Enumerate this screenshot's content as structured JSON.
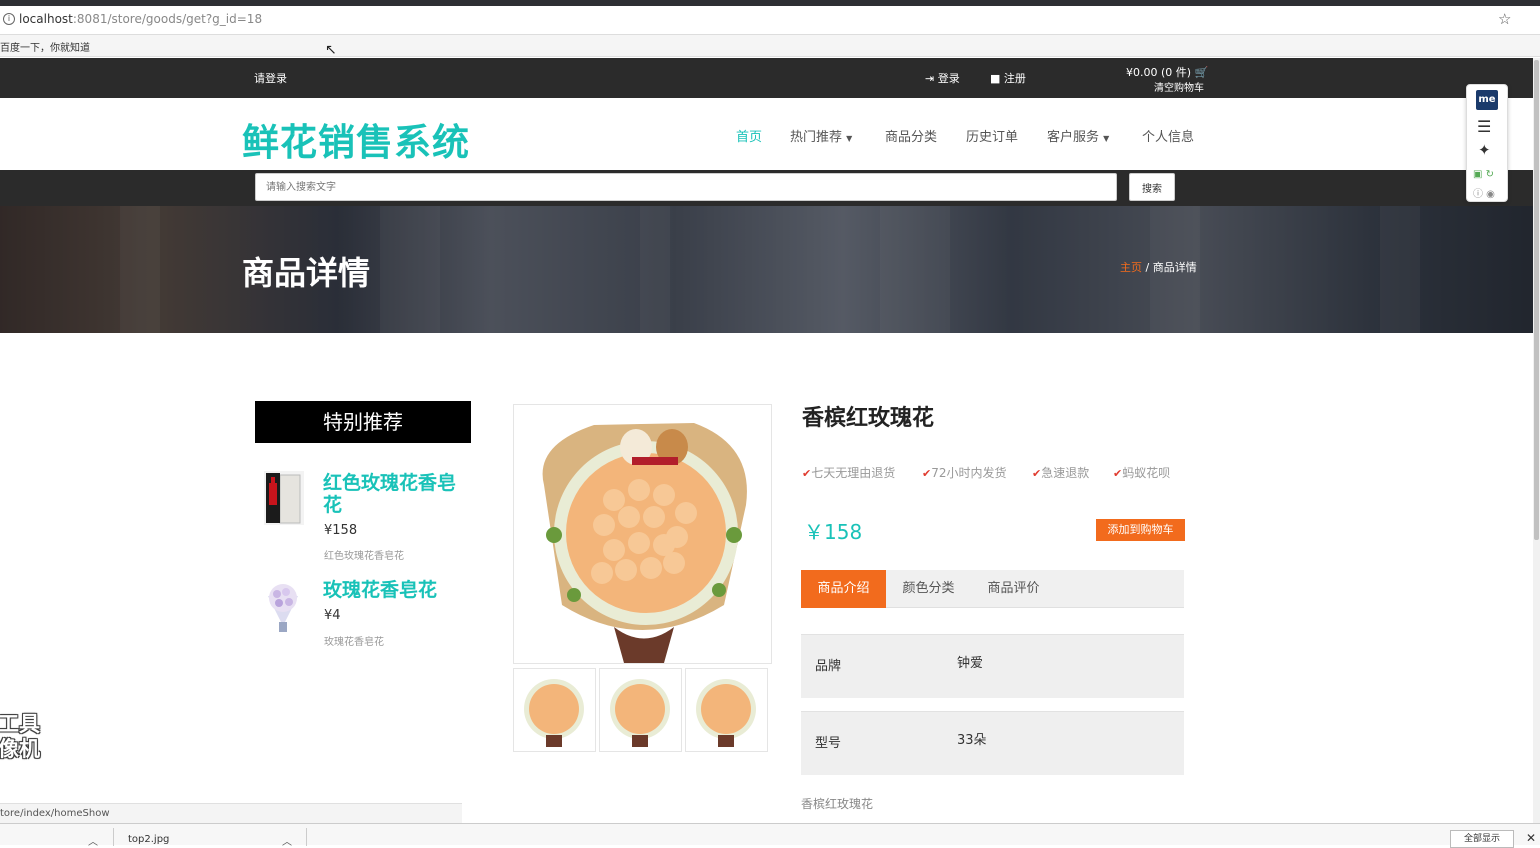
{
  "browser": {
    "url_host": "localhost",
    "url_rest": ":8081/store/goods/get?g_id=18",
    "bookmark": "百度一下，你就知道",
    "status_url": "tore/index/homeShow",
    "download_file": "top2.jpg",
    "show_all": "全部显示"
  },
  "topnav": {
    "please_login": "请登录",
    "login": "登录",
    "register": "注册",
    "cart_amount": "¥0.00 (0 件)",
    "cart_clear": "清空购物车"
  },
  "header": {
    "logo": "鲜花销售系统",
    "nav": [
      "首页",
      "热门推荐",
      "商品分类",
      "历史订单",
      "客户服务",
      "个人信息"
    ]
  },
  "search": {
    "placeholder": "请输入搜索文字",
    "button": "搜索"
  },
  "hero": {
    "title": "商品详情",
    "breadcrumb_home": "主页",
    "breadcrumb_sep": " / ",
    "breadcrumb_current": "商品详情"
  },
  "sidebar": {
    "heading": "特别推荐",
    "items": [
      {
        "title": "红色玫瑰花香皂花",
        "price": "¥158",
        "desc": "红色玫瑰花香皂花"
      },
      {
        "title": "玫瑰花香皂花",
        "price": "¥4",
        "desc": "玫瑰花香皂花"
      }
    ]
  },
  "product": {
    "title": "香槟红玫瑰花",
    "services": [
      "七天无理由退货",
      "72小时内发货",
      "急速退款",
      "蚂蚁花呗"
    ],
    "price": "￥158",
    "add_to_cart": "添加到购物车",
    "tabs": [
      "商品介绍",
      "颜色分类",
      "商品评价"
    ],
    "attributes": [
      {
        "key": "品牌",
        "value": "钟爱"
      },
      {
        "key": "型号",
        "value": "33朵"
      }
    ],
    "description": "香槟红玫瑰花"
  },
  "extension": {
    "badge": "me"
  },
  "watermark": {
    "line1": "工具",
    "line2": "像机"
  },
  "colors": {
    "brand_teal": "#19c2b8",
    "accent_orange": "#f26b1d",
    "dark_bar": "#2b2b2b"
  }
}
